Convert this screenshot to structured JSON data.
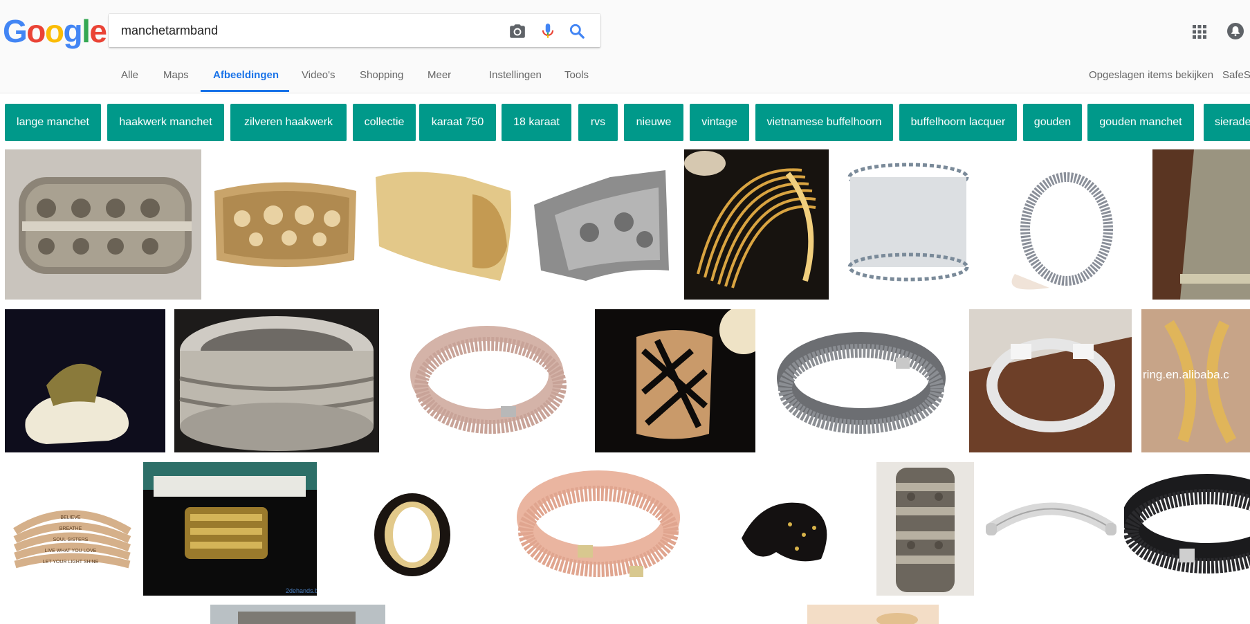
{
  "logo": {
    "letters": [
      "G",
      "o",
      "o",
      "g",
      "l",
      "e"
    ],
    "colors": [
      "#4285f4",
      "#ea4335",
      "#fbbc05",
      "#4285f4",
      "#34a853",
      "#ea4335"
    ]
  },
  "search": {
    "query": "manchetarmband"
  },
  "icons": {
    "camera": "camera-icon",
    "mic": "microphone-icon",
    "search": "search-icon",
    "apps": "apps-grid-icon",
    "notifications": "notifications-icon"
  },
  "tabs": [
    {
      "label": "Alle"
    },
    {
      "label": "Maps"
    },
    {
      "label": "Afbeeldingen",
      "active": true
    },
    {
      "label": "Video's"
    },
    {
      "label": "Shopping"
    },
    {
      "label": "Meer"
    },
    {
      "label": "Instellingen"
    },
    {
      "label": "Tools"
    }
  ],
  "header_right": {
    "saved": "Opgeslagen items bekijken",
    "safesearch": "SafeS"
  },
  "chips": [
    "lange manchet",
    "haakwerk manchet",
    "zilveren haakwerk",
    "collectie",
    "karaat 750",
    "18 karaat",
    "rvs",
    "nieuwe",
    "vintage",
    "vietnamese buffelhoorn",
    "buffelhoorn lacquer",
    "gouden",
    "gouden manchet",
    "sierade"
  ],
  "images": [
    {
      "desc": "silver ornate cuff with filigree"
    },
    {
      "desc": "gold filigree cuff"
    },
    {
      "desc": "gold textured flared cuff"
    },
    {
      "desc": "silver embossed cuff"
    },
    {
      "desc": "gold wire cuff on black"
    },
    {
      "desc": "silver crochet wire cuff"
    },
    {
      "desc": "silver crystal bangle"
    },
    {
      "desc": "knitted metal mesh bracelet"
    },
    {
      "desc": "gold cuff on quartz stone"
    },
    {
      "desc": "silver bangle with rope details"
    },
    {
      "desc": "rose crystal wrap bracelet"
    },
    {
      "desc": "gold cutout cuff on black"
    },
    {
      "desc": "grey crystal wrap bracelet"
    },
    {
      "desc": "twisted silver cuff"
    },
    {
      "desc": "gold open cuff",
      "watermark": "ring.en.alibaba.c"
    },
    {
      "desc": "gold stacked message cuffs",
      "engraving": [
        "BELIEVE",
        "BREATHE",
        "SOUL SISTERS",
        "LIVE WHAT YOU LOVE",
        "LET YOUR LIGHT SHINE"
      ]
    },
    {
      "desc": "gold bracelet in green box",
      "watermark": "2dehands.b"
    },
    {
      "desc": "black horn bangle"
    },
    {
      "desc": "pink crystal wrap bracelet"
    },
    {
      "desc": "black lacquer horn cuff"
    },
    {
      "desc": "antique silver stacked cuff"
    },
    {
      "desc": "silver engraved cuff"
    },
    {
      "desc": "black crystal wrap bracelet"
    },
    {
      "desc": "partial image"
    },
    {
      "desc": "partial image"
    }
  ]
}
